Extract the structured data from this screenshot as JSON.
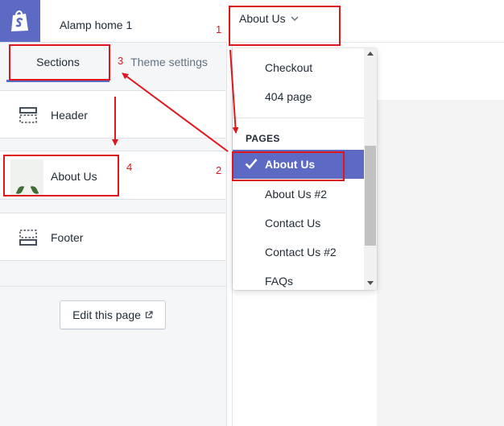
{
  "header": {
    "theme_name": "Alamp home 1",
    "page_selector": "About Us"
  },
  "tabs": [
    {
      "label": "Sections"
    },
    {
      "label": "Theme settings"
    }
  ],
  "sections": [
    {
      "label": "Header"
    },
    {
      "label": "About Us"
    },
    {
      "label": "Footer"
    }
  ],
  "edit_button": {
    "label": "Edit this page"
  },
  "dropdown": {
    "items_top": [
      "Checkout",
      "404 page"
    ],
    "group_heading": "PAGES",
    "selected": "About Us",
    "items_pages": [
      "About Us #2",
      "Contact Us",
      "Contact Us #2",
      "FAQs"
    ]
  },
  "annotations": {
    "n1": "1",
    "n2": "2",
    "n3": "3",
    "n4": "4"
  },
  "colors": {
    "brand": "#5c6ac4",
    "annotation": "#e0161d",
    "panel_bg": "#f4f6f8"
  },
  "icons": [
    "shopify-bag-icon",
    "chevron-down-icon",
    "header-layout-icon",
    "footer-layout-icon",
    "external-link-icon",
    "checkmark-icon"
  ]
}
